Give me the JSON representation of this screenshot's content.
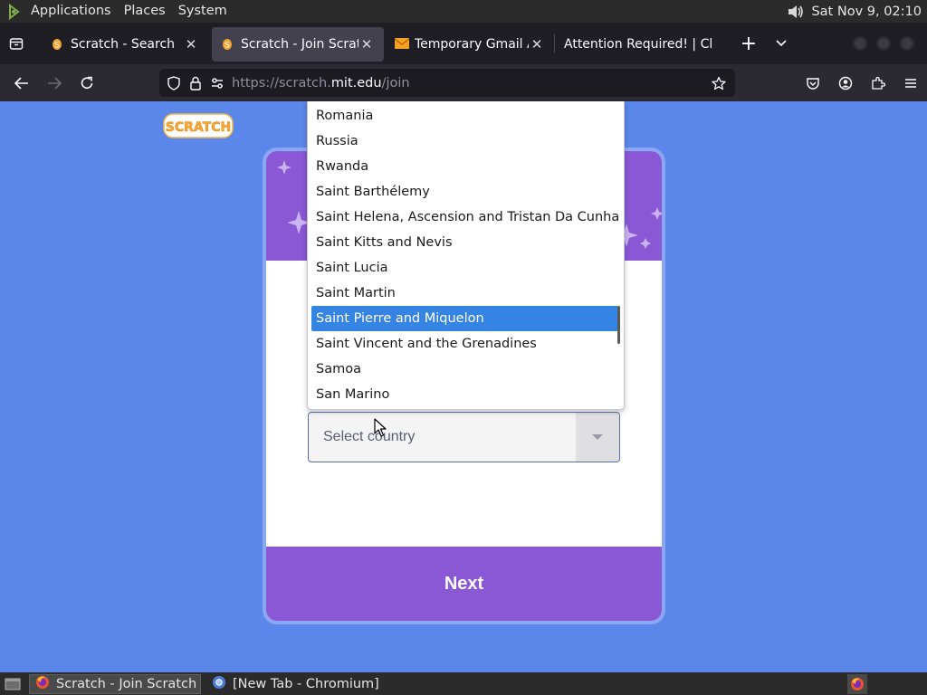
{
  "top_panel": {
    "menus": [
      "Applications",
      "Places",
      "System"
    ],
    "clock": "Sat Nov  9, 02:10",
    "icons": {
      "logo": "gnome-foot-icon",
      "volume": "volume-icon"
    }
  },
  "browser": {
    "tabs": [
      {
        "title": "Scratch - Search",
        "favicon": "scratch-cat-icon",
        "active": false
      },
      {
        "title": "Scratch - Join Scratch",
        "favicon": "scratch-cat-icon",
        "active": true
      },
      {
        "title": "Temporary Gmail Ac",
        "favicon": "mail-icon",
        "active": false
      },
      {
        "title": "Attention Required! | Cl",
        "favicon": "",
        "active": false
      }
    ],
    "url": {
      "prefix": "https://scratch.",
      "host": "mit.edu",
      "path": "/join"
    },
    "colors": {
      "tabstrip": "#1f1e25",
      "toolbar": "#2b2a33",
      "urlbar": "#1c1b22"
    }
  },
  "page": {
    "logo_text": "SCRATCH",
    "select": {
      "value": "Select country"
    },
    "next_label": "Next",
    "dropdown": {
      "options": [
        "Romania",
        "Russia",
        "Rwanda",
        "Saint Barthélemy",
        "Saint Helena, Ascension and Tristan Da Cunha",
        "Saint Kitts and Nevis",
        "Saint Lucia",
        "Saint Martin",
        "Saint Pierre and Miquelon",
        "Saint Vincent and the Grenadines",
        "Samoa",
        "San Marino"
      ],
      "highlighted": "Saint Pierre and Miquelon"
    },
    "colors": {
      "background": "#5b86ea",
      "purple": "#8a57d5",
      "highlight": "#3584e4"
    }
  },
  "taskbar": {
    "tasks": [
      {
        "label": "Scratch - Join Scratch ...",
        "icon": "firefox-icon",
        "active": true
      },
      {
        "label": "[New Tab - Chromium]",
        "icon": "chromium-icon",
        "active": false
      }
    ]
  }
}
